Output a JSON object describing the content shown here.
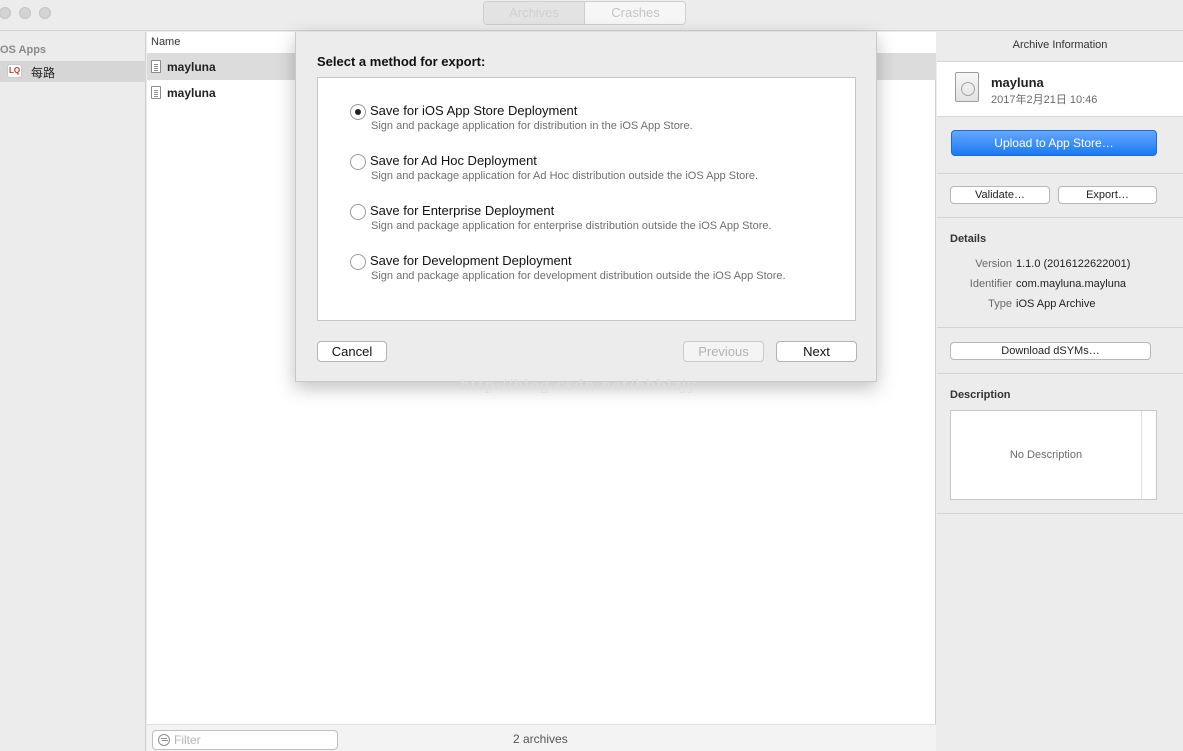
{
  "titlebar": {
    "tabs": [
      {
        "label": "Archives",
        "active": true
      },
      {
        "label": "Crashes",
        "active": false
      }
    ]
  },
  "sidebar": {
    "header": "OS Apps",
    "items": [
      {
        "label": "每路",
        "icon": "app-icon-meilu",
        "icon_text": "LQ",
        "selected": true
      }
    ]
  },
  "list": {
    "column_header": "Name",
    "rows": [
      {
        "label": "mayluna",
        "icon": "archive-doc-icon",
        "selected": true
      },
      {
        "label": "mayluna",
        "icon": "archive-doc-icon",
        "selected": false
      }
    ],
    "filter_placeholder": "Filter",
    "count_label": "2 archives"
  },
  "inspector": {
    "title": "Archive Information",
    "archive_name": "mayluna",
    "archive_date": "2017年2月21日 10:46",
    "upload_label": "Upload to App Store…",
    "validate_label": "Validate…",
    "export_label": "Export…",
    "details_heading": "Details",
    "details": [
      {
        "key": "Version",
        "value": "1.1.0 (2016122622001)"
      },
      {
        "key": "Identifier",
        "value": "com.mayluna.mayluna"
      },
      {
        "key": "Type",
        "value": "iOS App Archive"
      }
    ],
    "download_dsyms_label": "Download dSYMs…",
    "description_heading": "Description",
    "description_text": "No Description",
    "accent_color": "#1b79f3"
  },
  "sheet": {
    "title": "Select a method for export:",
    "selected_index": 0,
    "options": [
      {
        "title": "Save for iOS App Store Deployment",
        "desc": "Sign and package application for distribution in the iOS App Store."
      },
      {
        "title": "Save for Ad Hoc Deployment",
        "desc": "Sign and package application for Ad Hoc distribution outside the iOS App Store."
      },
      {
        "title": "Save for Enterprise Deployment",
        "desc": "Sign and package application for enterprise distribution outside the iOS App Store."
      },
      {
        "title": "Save for Development Deployment",
        "desc": "Sign and package application for development distribution outside the iOS App Store."
      }
    ],
    "cancel_label": "Cancel",
    "previous_label": "Previous",
    "previous_enabled": false,
    "next_label": "Next"
  },
  "watermark": "http://blog.csdn.net/hbblzjy"
}
